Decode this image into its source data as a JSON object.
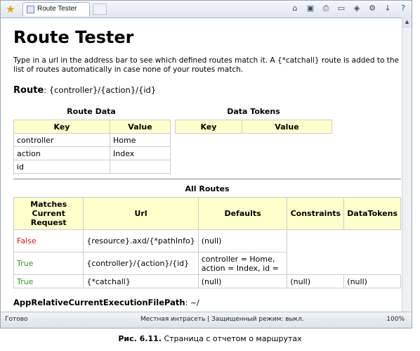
{
  "browser": {
    "tab_title": "Route Tester",
    "status_left": "Готово",
    "status_mid": "Местная интрасеть | Защищенный режим: выкл.",
    "zoom": "100%"
  },
  "page": {
    "title": "Route Tester",
    "intro": "Type in a url in the address bar to see which defined routes match it. A {*catchall} route is added to the list of routes automatically in case none of your routes match.",
    "route_label": "Route",
    "route_value": ": {controller}/{action}/{id}"
  },
  "route_data": {
    "caption": "Route Data",
    "headers": [
      "Key",
      "Value"
    ],
    "rows": [
      {
        "key": "controller",
        "value": "Home"
      },
      {
        "key": "action",
        "value": "Index"
      },
      {
        "key": "id",
        "value": ""
      }
    ]
  },
  "data_tokens": {
    "caption": "Data Tokens",
    "headers": [
      "Key",
      "Value"
    ]
  },
  "all_routes": {
    "caption": "All Routes",
    "headers": [
      "Matches Current Request",
      "Url",
      "Defaults",
      "Constraints",
      "DataTokens"
    ],
    "rows": [
      {
        "match": "False",
        "url": "{resource}.axd/{*pathInfo}",
        "defaults": "(null)",
        "constraints": "",
        "datatokens": ""
      },
      {
        "match": "True",
        "url": "{controller}/{action}/{id}",
        "defaults": "controller = Home, action = Index, id =",
        "constraints": "",
        "datatokens": ""
      },
      {
        "match": "True",
        "url": "{*catchall}",
        "defaults": "(null)",
        "constraints": "(null)",
        "datatokens": "(null)"
      }
    ]
  },
  "footer": {
    "label": "AppRelativeCurrentExecutionFilePath",
    "value": ": ~/"
  },
  "figure_caption": {
    "label": "Рис. 6.11.",
    "text": " Страница с отчетом о маршрутах"
  },
  "colors": {
    "header_bg": "#ffffcc",
    "false_text": "#e01818",
    "true_text": "#2b9a1a"
  }
}
